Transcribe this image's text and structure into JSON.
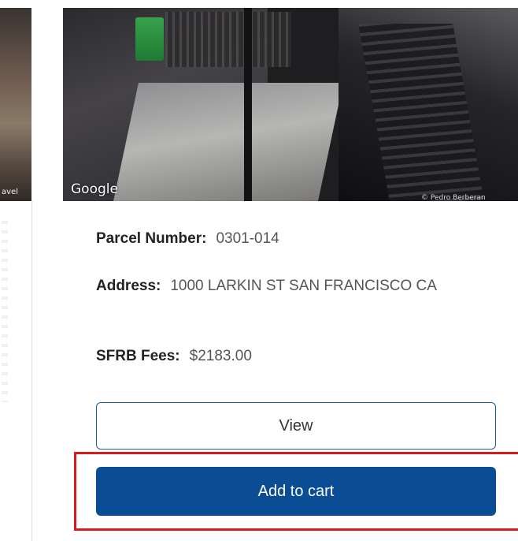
{
  "left_photo": {
    "label": "avel"
  },
  "photo": {
    "brand": "Google",
    "credit": "© Pedro Berberan"
  },
  "details": {
    "parcel_label": "Parcel Number:",
    "parcel_value": "0301-014",
    "address_label": "Address:",
    "address_value": "1000 LARKIN ST SAN FRANCISCO CA",
    "fees_label": "SFRB Fees:",
    "fees_value": "$2183.00"
  },
  "actions": {
    "view_label": "View",
    "add_to_cart_label": "Add to cart"
  },
  "colors": {
    "primary": "#0a4d94",
    "highlight": "#d81a1a"
  }
}
